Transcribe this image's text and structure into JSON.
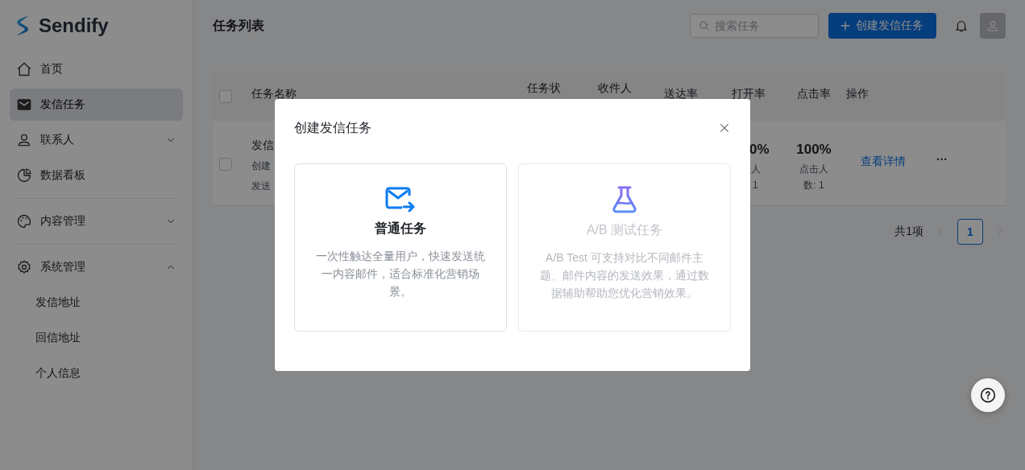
{
  "brand": {
    "name": "Sendify"
  },
  "sidebar": {
    "items": [
      {
        "kind": "link",
        "label": "首页",
        "selected": false
      },
      {
        "kind": "link",
        "label": "发信任务",
        "selected": true
      },
      {
        "kind": "group",
        "label": "联系人",
        "selected": false,
        "expanded": false
      },
      {
        "kind": "link",
        "label": "数据看板",
        "selected": false
      },
      {
        "kind": "divider"
      },
      {
        "kind": "group",
        "label": "内容管理",
        "selected": false,
        "expanded": false
      },
      {
        "kind": "divider"
      },
      {
        "kind": "group",
        "label": "系统管理",
        "selected": false,
        "expanded": true,
        "children": [
          {
            "label": "发信地址",
            "selected": false
          },
          {
            "label": "回信地址",
            "selected": false
          },
          {
            "label": "个人信息",
            "selected": false
          }
        ]
      }
    ]
  },
  "header": {
    "title": "任务列表",
    "search": {
      "placeholder": "搜索任务"
    },
    "create_button": "创建发信任务"
  },
  "table": {
    "columns": [
      "任务名称",
      "任务状",
      "收件人",
      "送达率",
      "打开率",
      "点击率",
      "操作"
    ],
    "select_all": {
      "checked": false
    },
    "rows": [
      {
        "checked": false,
        "name": "发信",
        "created": "创建",
        "sent": "发送",
        "open_rate": "0%",
        "open_label": "人",
        "open_count": "1",
        "click_rate": "100%",
        "click_label": "点击人",
        "click_count": "数: 1",
        "action": "查看详情",
        "more": "···"
      }
    ]
  },
  "pagination": {
    "total": "共1项",
    "pages": [
      {
        "label": "1",
        "selected": true
      }
    ]
  },
  "modal": {
    "title": "创建发信任务",
    "options": [
      {
        "kind": "mail",
        "title": "普通任务",
        "description": "一次性触达全量用户，快速发送统一内容邮件，适合标准化营销场景。",
        "disabled": false
      },
      {
        "kind": "flask",
        "title": "A/B 测试任务",
        "description": "A/B Test 可支持对比不同邮件主题、邮件内容的发送效果，通过数据辅助帮助您优化营销效果。",
        "disabled": true
      }
    ]
  }
}
